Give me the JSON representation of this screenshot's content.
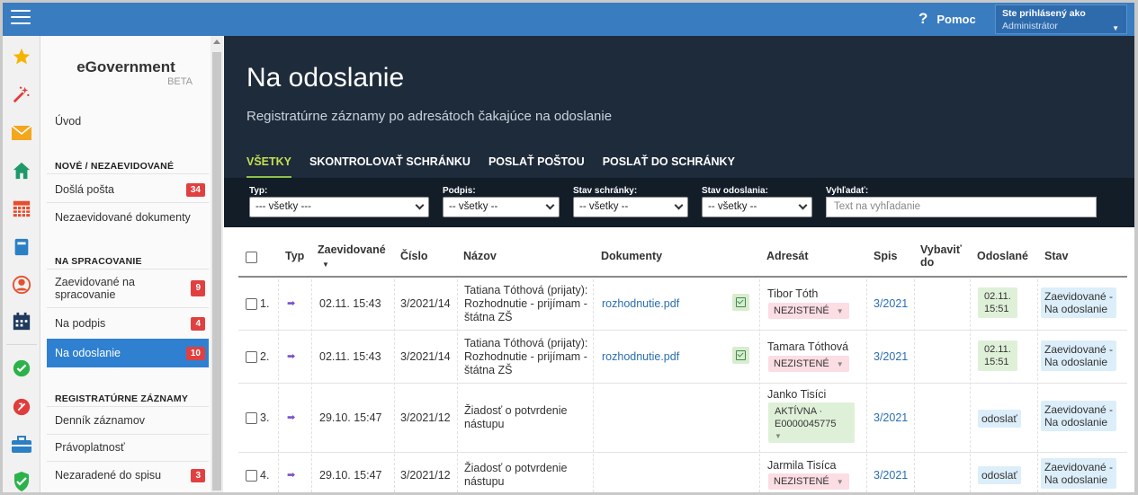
{
  "topbar": {
    "help_label": "Pomoc",
    "user_caption": "Ste prihlásený ako",
    "user_name": "Administrátor"
  },
  "rail_icons": [
    "star-icon",
    "wand-icon",
    "envelope-icon",
    "home-icon",
    "calendar-grid-icon",
    "book-icon",
    "person-icon",
    "schedule-icon",
    "check-circle-icon",
    "nosign-icon",
    "briefcase-icon",
    "shield-check-icon"
  ],
  "nav": {
    "brand": "eGovernment",
    "beta": "BETA",
    "intro": "Úvod",
    "section_new": "NOVÉ / NEZAEVIDOVANÉ",
    "incoming": "Došlá pošta",
    "incoming_count": "34",
    "unregistered": "Nezaevidované dokumenty",
    "section_processing": "NA SPRACOVANIE",
    "to_process": "Zaevidované na spracovanie",
    "to_process_count": "9",
    "to_sign": "Na podpis",
    "to_sign_count": "4",
    "to_send": "Na odoslanie",
    "to_send_count": "10",
    "section_records": "REGISTRATÚRNE ZÁZNAMY",
    "journal": "Denník záznamov",
    "validity": "Právoplatnosť",
    "unfiled": "Nezaradené do spisu",
    "unfiled_count": "3"
  },
  "header": {
    "title": "Na odoslanie",
    "subtitle": "Registratúrne záznamy po adresátoch čakajúce na odoslanie"
  },
  "tabs": [
    "VŠETKY",
    "SKONTROLOVAŤ SCHRÁNKU",
    "POSLAŤ POŠTOU",
    "POSLAŤ DO SCHRÁNKY"
  ],
  "filters": {
    "type_label": "Typ:",
    "type_value": "--- všetky ---",
    "sign_label": "Podpis:",
    "sign_value": "-- všetky --",
    "box_label": "Stav schránky:",
    "box_value": "-- všetky --",
    "send_label": "Stav odoslania:",
    "send_value": "-- všetky --",
    "search_label": "Vyhľadať:",
    "search_placeholder": "Text na vyhľadanie"
  },
  "columns": {
    "typ": "Typ",
    "registered": "Zaevidované",
    "number": "Číslo",
    "name": "Názov",
    "documents": "Dokumenty",
    "addressee": "Adresát",
    "file": "Spis",
    "pickup_1": "Vybaviť",
    "pickup_2": "do",
    "sent": "Odoslané",
    "state": "Stav"
  },
  "rows": [
    {
      "num": "1.",
      "date": "02.11. 15:43",
      "cislo": "3/2021/14",
      "name1": "Tatiana Tóthová (prijaty):",
      "name2": "Rozhodnutie - prijímam -",
      "name3": "štátna ZŠ",
      "doc": "rozhodnutie.pdf",
      "addr": "Tibor Tóth",
      "tag": "NEZISTENÉ",
      "spis": "3/2021",
      "sent1": "02.11.",
      "sent2": "15:51",
      "state1": "Zaevidované -",
      "state2": "Na odoslanie"
    },
    {
      "num": "2.",
      "date": "02.11. 15:43",
      "cislo": "3/2021/14",
      "name1": "Tatiana Tóthová (prijaty):",
      "name2": "Rozhodnutie - prijímam -",
      "name3": "štátna ZŠ",
      "doc": "rozhodnutie.pdf",
      "addr": "Tamara Tóthová",
      "tag": "NEZISTENÉ",
      "spis": "3/2021",
      "sent1": "02.11.",
      "sent2": "15:51",
      "state1": "Zaevidované -",
      "state2": "Na odoslanie"
    },
    {
      "num": "3.",
      "date": "29.10. 15:47",
      "cislo": "3/2021/12",
      "name1": "Žiadosť o potvrdenie",
      "name2": "nástupu",
      "addr": "Janko Tisíci",
      "tag1": "AKTÍVNA ·",
      "tag2": "E0000045775",
      "spis": "3/2021",
      "sent": "odoslať",
      "state1": "Zaevidované -",
      "state2": "Na odoslanie"
    },
    {
      "num": "4.",
      "date": "29.10. 15:47",
      "cislo": "3/2021/12",
      "name1": "Žiadosť o potvrdenie",
      "name2": "nástupu",
      "addr": "Jarmila Tisíca",
      "tag": "NEZISTENÉ",
      "spis": "3/2021",
      "sent": "odoslať",
      "state1": "Zaevidované -",
      "state2": "Na odoslanie"
    }
  ]
}
